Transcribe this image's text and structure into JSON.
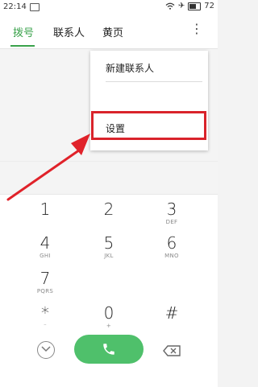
{
  "status_bar": {
    "time": "22:14",
    "battery": "72"
  },
  "tabs": [
    {
      "label": "拨号",
      "active": true
    },
    {
      "label": "联系人",
      "active": false
    },
    {
      "label": "黄页",
      "active": false
    }
  ],
  "menu": {
    "items": [
      {
        "label": "新建联系人"
      },
      {
        "label": "设置"
      }
    ]
  },
  "keypad": {
    "keys": [
      {
        "num": "1",
        "sub": ""
      },
      {
        "num": "2",
        "sub": ""
      },
      {
        "num": "3",
        "sub": "DEF"
      },
      {
        "num": "4",
        "sub": "GHI"
      },
      {
        "num": "5",
        "sub": "JKL"
      },
      {
        "num": "6",
        "sub": "MNO"
      },
      {
        "num": "7",
        "sub": "PQRS"
      },
      {
        "num": "",
        "sub": ""
      },
      {
        "num": "",
        "sub": ""
      },
      {
        "num": "*",
        "sub": "⁻"
      },
      {
        "num": "0",
        "sub": "+"
      },
      {
        "num": "#",
        "sub": ""
      }
    ]
  },
  "colors": {
    "accent": "#3aa24b",
    "call_button": "#4fc06b",
    "highlight": "#d9232b"
  }
}
